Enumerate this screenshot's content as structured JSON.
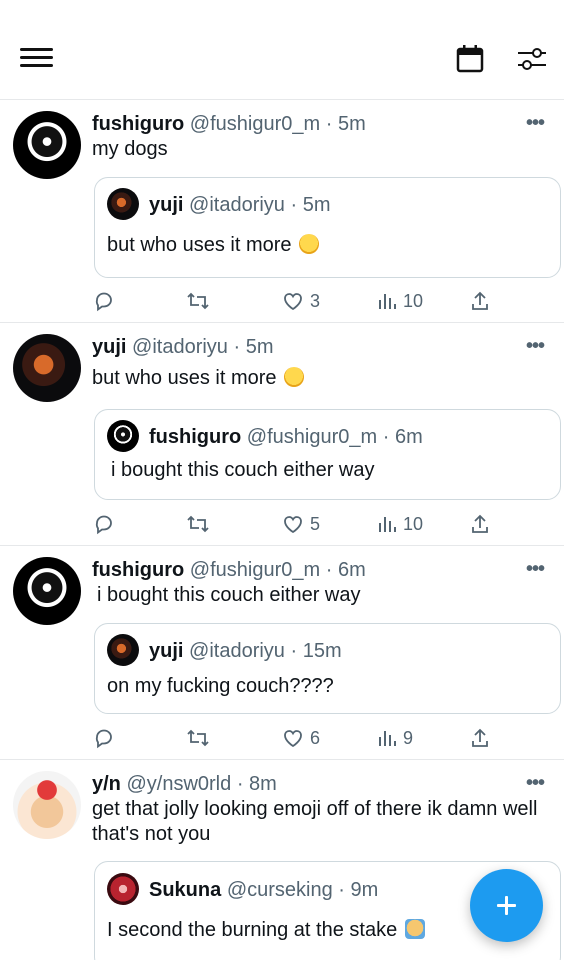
{
  "posts": [
    {
      "name": "fushiguro",
      "handle": "@fushigur0_m",
      "time": "5m",
      "more": "•••",
      "text": "my dogs",
      "quote": {
        "name": "yuji",
        "handle": "@itadoriyu",
        "time": "5m",
        "text": "but who uses it more"
      },
      "likes": "3",
      "views": "10"
    },
    {
      "name": "yuji",
      "handle": "@itadoriyu",
      "time": "5m",
      "more": "•••",
      "text": "but who uses it more",
      "quote": {
        "name": "fushiguro",
        "handle": "@fushigur0_m",
        "time": "6m",
        "text": "i bought this couch either way"
      },
      "likes": "5",
      "views": "10"
    },
    {
      "name": "fushiguro",
      "handle": "@fushigur0_m",
      "time": "6m",
      "more": "•••",
      "text": "i bought this couch either way",
      "quote": {
        "name": "yuji",
        "handle": "@itadoriyu",
        "time": "15m",
        "text": "on my fucking couch????"
      },
      "likes": "6",
      "views": "9"
    },
    {
      "name": "y/n",
      "handle": "@y/nsw0rld",
      "time": "8m",
      "more": "•••",
      "text": "get that jolly looking emoji off of there ik damn well that's not you",
      "quote": {
        "name": "Sukuna",
        "handle": "@curseking",
        "time": "9m",
        "text": "I second the burning at the stake"
      }
    }
  ],
  "separator": "·",
  "icons": {
    "menu": "hamburger-icon",
    "calendar": "calendar-icon",
    "filter": "filter-icon",
    "compose": "plus-icon"
  },
  "colors": {
    "accent": "#1d9bf0",
    "meta": "#536471"
  }
}
